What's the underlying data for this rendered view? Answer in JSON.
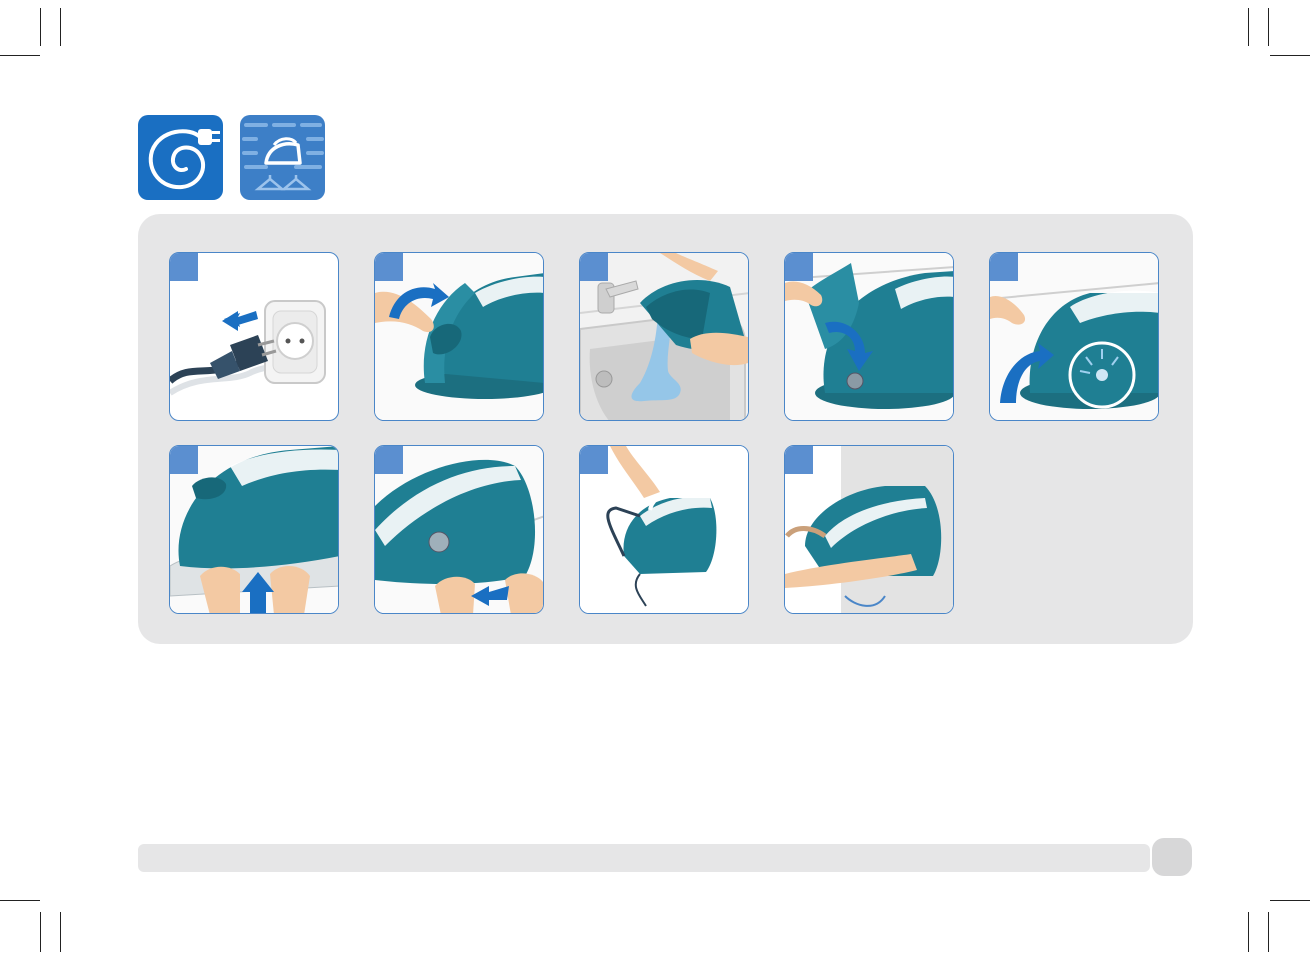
{
  "icons": [
    {
      "name": "unplug-cord-icon",
      "bg": "#1a6fc2"
    },
    {
      "name": "storage-iron-icon",
      "bg": "#3d7fc7"
    }
  ],
  "colors": {
    "panel_bg": "#e6e6e7",
    "card_border": "#4a86c8",
    "badge_bg": "#5b8fd0",
    "appliance_teal": "#1f7f93",
    "arrow_blue": "#1a6fc2",
    "skin": "#f3c9a3",
    "water": "#8ec4ea"
  },
  "steps": [
    {
      "id": 1,
      "number": "",
      "scene": "unplug-from-socket"
    },
    {
      "id": 2,
      "number": "",
      "scene": "open-cover"
    },
    {
      "id": 3,
      "number": "",
      "scene": "empty-water-in-sink"
    },
    {
      "id": 4,
      "number": "",
      "scene": "close-cover"
    },
    {
      "id": 5,
      "number": "",
      "scene": "cover-click-locked"
    },
    {
      "id": 6,
      "number": "",
      "scene": "lift-base-front"
    },
    {
      "id": 7,
      "number": "",
      "scene": "lock-iron-to-base"
    },
    {
      "id": 8,
      "number": "",
      "scene": "carry-by-handle"
    },
    {
      "id": 9,
      "number": "",
      "scene": "store-against-wall"
    }
  ],
  "footer": {
    "page_number": ""
  }
}
